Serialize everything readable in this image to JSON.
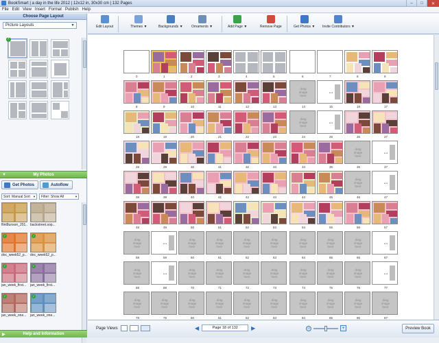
{
  "window": {
    "title": "BookSmart  |  a day in the life 2012  |  12x12 in, 30x30 cm  |  132 Pages",
    "minimize": "–",
    "maximize": "□",
    "close": "✕"
  },
  "menu": [
    "File",
    "Edit",
    "View",
    "Insert",
    "Format",
    "Publish",
    "Help"
  ],
  "left_panel": {
    "header": "Choose Page Layout",
    "layout_select": "Picture Layouts",
    "my_photos_header": "My Photos",
    "get_photos": "Get Photos",
    "autoflow": "Autoflow",
    "sort_label": "Sort:  Manual Sort",
    "filter_label": "Filter:  Show All",
    "photos": [
      {
        "caption": "flint8unson_201...",
        "checked": false,
        "color": "#c79a4a"
      },
      {
        "caption": "backstreet.sop...",
        "checked": false,
        "color": "#b8a68a"
      },
      {
        "caption": "doc_week52_p...",
        "checked": true,
        "color": "#e0752c"
      },
      {
        "caption": "doc_week52_p...",
        "checked": true,
        "color": "#d9923f"
      },
      {
        "caption": "jan_week_first...",
        "checked": true,
        "color": "#c96b7a"
      },
      {
        "caption": "jan_week_first...",
        "checked": true,
        "color": "#8a6f9e"
      },
      {
        "caption": "jan_week_one...",
        "checked": true,
        "color": "#b36a5e"
      },
      {
        "caption": "jan_week_one...",
        "checked": true,
        "color": "#5f8fbf"
      }
    ],
    "help_bar": "Help and Information"
  },
  "toolbar": [
    {
      "label": "Edit Layout",
      "icon": "edit-layout-icon",
      "color": "#5b8fd6"
    },
    {
      "label": "Themes ▼",
      "icon": "themes-icon",
      "color": "#7aa3d9"
    },
    {
      "label": "Backgrounds ▼",
      "icon": "backgrounds-icon",
      "color": "#4a7fc3"
    },
    {
      "label": "Ornaments ▼",
      "icon": "ornaments-icon",
      "color": "#6e8fb8"
    },
    {
      "label": "Add Page ▼",
      "icon": "add-page-icon",
      "color": "#3da34a"
    },
    {
      "label": "Remove Page",
      "icon": "remove-page-icon",
      "color": "#d24b3f"
    },
    {
      "label": "Get Photos ▼",
      "icon": "get-photos-icon",
      "color": "#3c79c8"
    },
    {
      "label": "Invite Contributors ▼",
      "icon": "invite-contributors-icon",
      "color": "#4f86cc"
    }
  ],
  "drag_text": "drag image here",
  "spread_rows": [
    [
      [
        "0",
        "1"
      ],
      [
        "2",
        "3"
      ],
      [
        "4",
        "5"
      ],
      [
        "6",
        "7"
      ],
      [
        "8",
        "9"
      ]
    ],
    [
      [
        "8",
        "9"
      ],
      [
        "10",
        "11"
      ],
      [
        "12",
        "13"
      ],
      [
        "14",
        "15"
      ],
      [
        "16",
        "17"
      ]
    ],
    [
      [
        "18",
        "19"
      ],
      [
        "20",
        "21"
      ],
      [
        "22",
        "23"
      ],
      [
        "24",
        "25"
      ],
      [
        "26",
        "27"
      ]
    ],
    [
      [
        "28",
        "29"
      ],
      [
        "30",
        "31"
      ],
      [
        "32",
        "33"
      ],
      [
        "34",
        "35"
      ],
      [
        "36",
        "37"
      ]
    ],
    [
      [
        "38",
        "39"
      ],
      [
        "40",
        "41"
      ],
      [
        "42",
        "43"
      ],
      [
        "44",
        "45"
      ],
      [
        "46",
        "47"
      ]
    ],
    [
      [
        "48",
        "49"
      ],
      [
        "50",
        "51"
      ],
      [
        "52",
        "53"
      ],
      [
        "54",
        "55"
      ],
      [
        "56",
        "57"
      ]
    ],
    [
      [
        "58",
        "59"
      ],
      [
        "60",
        "61"
      ],
      [
        "62",
        "63"
      ],
      [
        "64",
        "65"
      ],
      [
        "66",
        "67"
      ]
    ],
    [
      [
        "68",
        "69"
      ],
      [
        "70",
        "71"
      ],
      [
        "72",
        "73"
      ],
      [
        "74",
        "75"
      ],
      [
        "76",
        "77"
      ]
    ],
    [
      [
        "78",
        "79"
      ],
      [
        "80",
        "81"
      ],
      [
        "82",
        "83"
      ],
      [
        "84",
        "85"
      ],
      [
        "86",
        "87"
      ]
    ]
  ],
  "bottom": {
    "page_views_label": "Page Views",
    "page_indicator": "Page 18 of 132",
    "prev": "◀",
    "next": "▶",
    "zoom_out": "−",
    "zoom_in": "+",
    "preview_button": "Preview Book"
  }
}
